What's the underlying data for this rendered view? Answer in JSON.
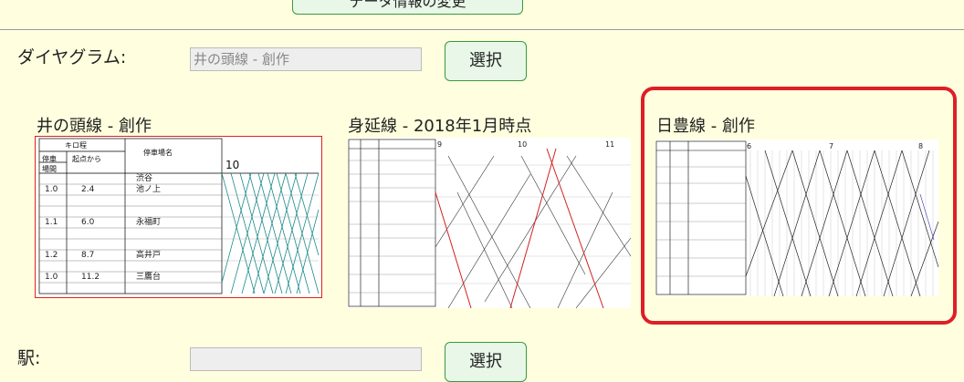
{
  "top_button": {
    "label": "データ情報の変更"
  },
  "diagram_row": {
    "label": "ダイヤグラム:",
    "input_value": "井の頭線 - 創作",
    "select_label": "選択"
  },
  "thumbnails": [
    {
      "title": "井の頭線 - 創作",
      "selected": false,
      "border": "#dd2222"
    },
    {
      "title": "身延線 - 2018年1月時点",
      "selected": false
    },
    {
      "title": "日豊線 - 創作",
      "selected": true
    }
  ],
  "station_row": {
    "label": "駅:",
    "input_value": "",
    "select_label": "選択"
  },
  "colors": {
    "accent_green": "#3a9a3a",
    "button_bg": "#e8f7e8",
    "page_bg": "#ffffdf",
    "highlight_red": "#dd1f26"
  }
}
